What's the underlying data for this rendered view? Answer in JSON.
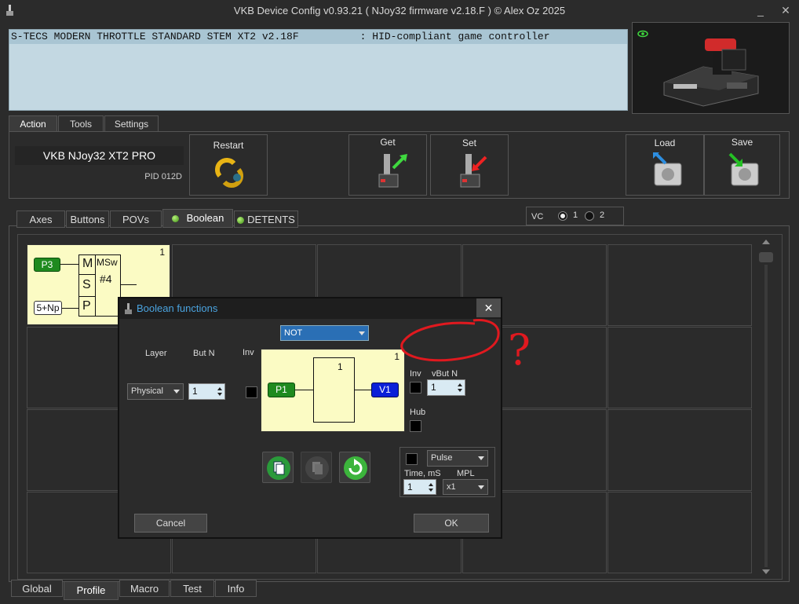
{
  "window": {
    "title": "VKB Device Config v0.93.21 ( NJoy32 firmware v2.18.F ) © Alex Oz 2025"
  },
  "device_list": {
    "rows": [
      "S-TECS MODERN THROTTLE STANDARD STEM XT2 v2.18F          : HID-compliant game controller"
    ]
  },
  "main_tabs": [
    "Action",
    "Tools",
    "Settings"
  ],
  "device": {
    "name": "VKB NJoy32 XT2 PRO",
    "pid": "PID 012D"
  },
  "toolbar": {
    "restart": "Restart",
    "get": "Get",
    "set": "Set",
    "load": "Load",
    "save": "Save"
  },
  "sub_tabs": [
    "Axes",
    "Buttons",
    "POVs",
    "Boolean",
    "DETENTS"
  ],
  "vc": {
    "label": "VC",
    "options": [
      "1",
      "2"
    ],
    "selected": "1"
  },
  "block": {
    "corner_num": "1",
    "in_top": "P3",
    "in_bottom": "5+Np",
    "rows": [
      "M",
      "S",
      "P"
    ],
    "func": "MSw",
    "num": "#4"
  },
  "dialog": {
    "title": "Boolean functions",
    "function_select": "NOT",
    "layer_label": "Layer",
    "butn_label": "But N",
    "inv_label": "Inv",
    "layer_value": "Physical",
    "butn_value": "1",
    "diagram": {
      "corner": "1",
      "gate_num": "1",
      "input": "P1",
      "output": "V1"
    },
    "right_inv_label": "Inv",
    "vbutn_label": "vBut N",
    "vbutn_value": "1",
    "hub_label": "Hub",
    "pulse_value": "Pulse",
    "time_label": "Time, mS",
    "time_value": "1",
    "mpl_label": "MPL",
    "mpl_value": "x1",
    "cancel": "Cancel",
    "ok": "OK"
  },
  "annotation": {
    "text": "?"
  },
  "bottom_tabs": [
    "Global",
    "Profile",
    "Macro",
    "Test",
    "Info"
  ],
  "colors": {
    "accent_blue": "#4aa3df",
    "green_button": "#1f8a1f",
    "blue_button": "#0a1fd8",
    "annotation_red": "#e0191f"
  }
}
